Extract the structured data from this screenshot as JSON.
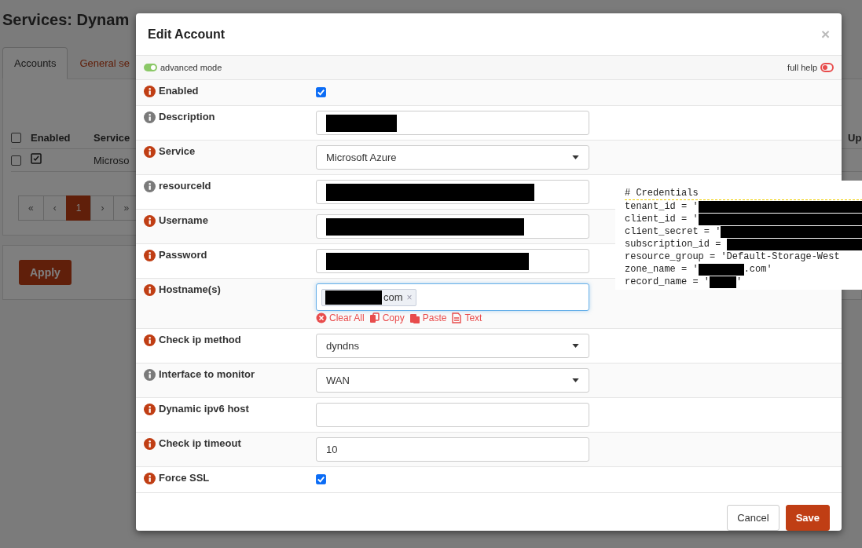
{
  "page": {
    "title": "Services: Dynam",
    "tabs": [
      {
        "label": "Accounts",
        "selected": true
      },
      {
        "label": "General se",
        "selected": false
      }
    ],
    "table": {
      "select_all": false,
      "columns": [
        "Enabled",
        "Service",
        "Up"
      ],
      "rows": [
        {
          "selected": false,
          "enabled": true,
          "service": "Microso"
        }
      ]
    },
    "pagination": [
      {
        "label": "«",
        "selected": false
      },
      {
        "label": "‹",
        "selected": false
      },
      {
        "label": "1",
        "selected": true
      },
      {
        "label": "›",
        "selected": false
      },
      {
        "label": "»",
        "selected": false
      }
    ],
    "apply_button": "Apply"
  },
  "dialog": {
    "title": "Edit Account",
    "close": "×",
    "advanced_mode": {
      "label": "advanced mode",
      "on": true
    },
    "full_help": {
      "label": "full help",
      "on": false
    },
    "fields": [
      {
        "label": "Enabled",
        "color": "#c03e14",
        "kind": "checkbox",
        "checked": true
      },
      {
        "label": "Description",
        "color": "#7a7a7a",
        "kind": "text",
        "redacted": true
      },
      {
        "label": "Service",
        "color": "#c03e14",
        "kind": "select",
        "value": "Microsoft Azure"
      },
      {
        "label": "resourceId",
        "color": "#7a7a7a",
        "kind": "text",
        "redacted": true
      },
      {
        "label": "Username",
        "color": "#c03e14",
        "kind": "text",
        "redacted": true
      },
      {
        "label": "Password",
        "color": "#c03e14",
        "kind": "text",
        "redacted": true
      },
      {
        "label": "Hostname(s)",
        "color": "#c03e14",
        "kind": "tags",
        "tags": [
          {
            "text": "com",
            "redacted": true,
            "remove": "×"
          }
        ],
        "actions": [
          "Clear All",
          "Copy",
          "Paste",
          "Text"
        ]
      },
      {
        "label": "Check ip method",
        "color": "#c03e14",
        "kind": "select",
        "value": "dyndns"
      },
      {
        "label": "Interface to monitor",
        "color": "#7a7a7a",
        "kind": "select",
        "value": "WAN"
      },
      {
        "label": "Dynamic ipv6 host",
        "color": "#c03e14",
        "kind": "text",
        "redacted": false
      },
      {
        "label": "Check ip timeout",
        "color": "#c03e14",
        "kind": "text",
        "value": "10",
        "redacted": false
      },
      {
        "label": "Force SSL",
        "color": "#c03e14",
        "kind": "checkbox",
        "checked": true
      }
    ],
    "buttons": [
      {
        "label": "Cancel",
        "kind": "secondary"
      },
      {
        "label": "Save",
        "kind": "primary"
      }
    ]
  },
  "code_snippet": {
    "lines": [
      {
        "before": "# Credentials",
        "redacted": false
      },
      {
        "before": "tenant_id = '",
        "redacted": true
      },
      {
        "before": "client_id = '",
        "redacted": true
      },
      {
        "before": "client_secret = '",
        "redacted": true
      },
      {
        "before": "subscription_id = ",
        "redacted": true
      },
      {
        "before": "resource_group = 'Default-Storage-West",
        "redacted": false
      },
      {
        "before": "zone_name = '",
        "redacted": true,
        "after": ".com'"
      },
      {
        "before": "record_name = '",
        "redacted": true,
        "after": "'"
      }
    ]
  }
}
